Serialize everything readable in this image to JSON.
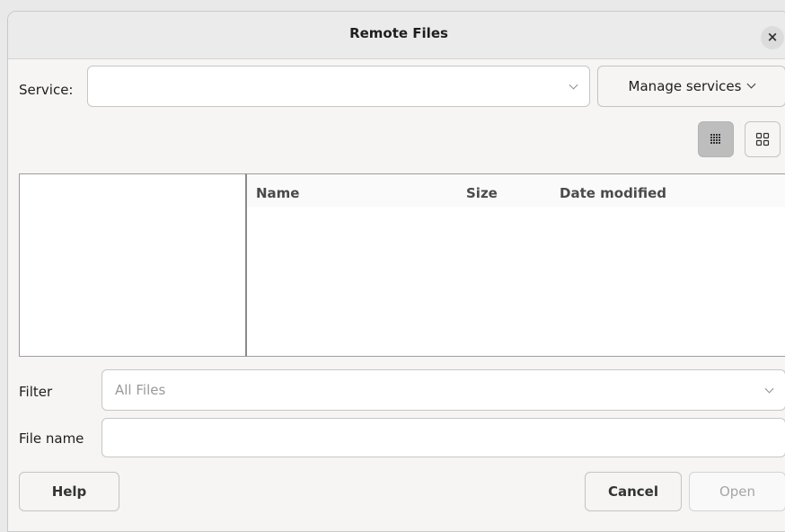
{
  "dialog": {
    "title": "Remote Files",
    "close_symbol": "×"
  },
  "service": {
    "label": "Service:",
    "value": "",
    "manage_button_label": "Manage services"
  },
  "view_toggle": {
    "list_icon": "list-view-icon",
    "icon_view_icon": "grid-view-icon",
    "selected": "list"
  },
  "file_list": {
    "columns": [
      "Name",
      "Size",
      "Date modified"
    ],
    "rows": []
  },
  "filter": {
    "label": "Filter",
    "value": "All Files"
  },
  "file_name": {
    "label": "File name",
    "value": ""
  },
  "buttons": {
    "help": "Help",
    "cancel": "Cancel",
    "open": "Open"
  }
}
